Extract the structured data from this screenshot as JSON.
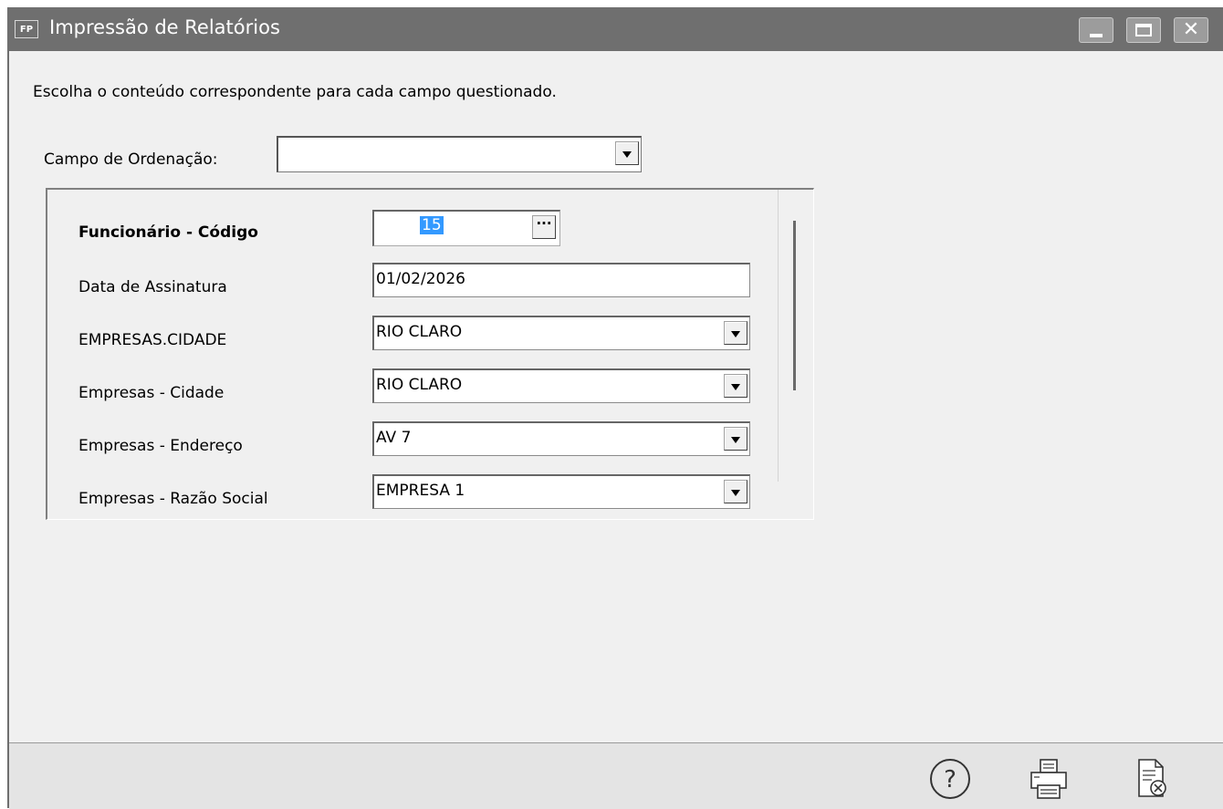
{
  "window": {
    "app_badge": "FP",
    "title": "Impressão de Relatórios",
    "controls": {
      "minimize": "minimize-icon",
      "maximize": "maximize-icon",
      "close": "✕"
    }
  },
  "instructions": "Escolha o conteúdo correspondente para cada campo questionado.",
  "ordering": {
    "label": "Campo de Ordenação:",
    "value": ""
  },
  "params": {
    "rows": [
      {
        "label": "Funcionário - Código",
        "value": "15"
      },
      {
        "label": "Data de Assinatura",
        "value": "01/02/2026"
      },
      {
        "label": "EMPRESAS.CIDADE",
        "value": "RIO CLARO"
      },
      {
        "label": "Empresas - Cidade",
        "value": "RIO CLARO"
      },
      {
        "label": "Empresas - Endereço",
        "value": "AV 7"
      },
      {
        "label": "Empresas - Razão Social",
        "value": "EMPRESA 1"
      }
    ],
    "lookup_button": "···"
  },
  "footer": {
    "icons": [
      "help-icon",
      "print-icon",
      "cancel-report-icon"
    ]
  },
  "colors": {
    "titlebar": "#6f6f6f",
    "selection": "#3399ff",
    "window_bg": "#f0f0f0"
  }
}
